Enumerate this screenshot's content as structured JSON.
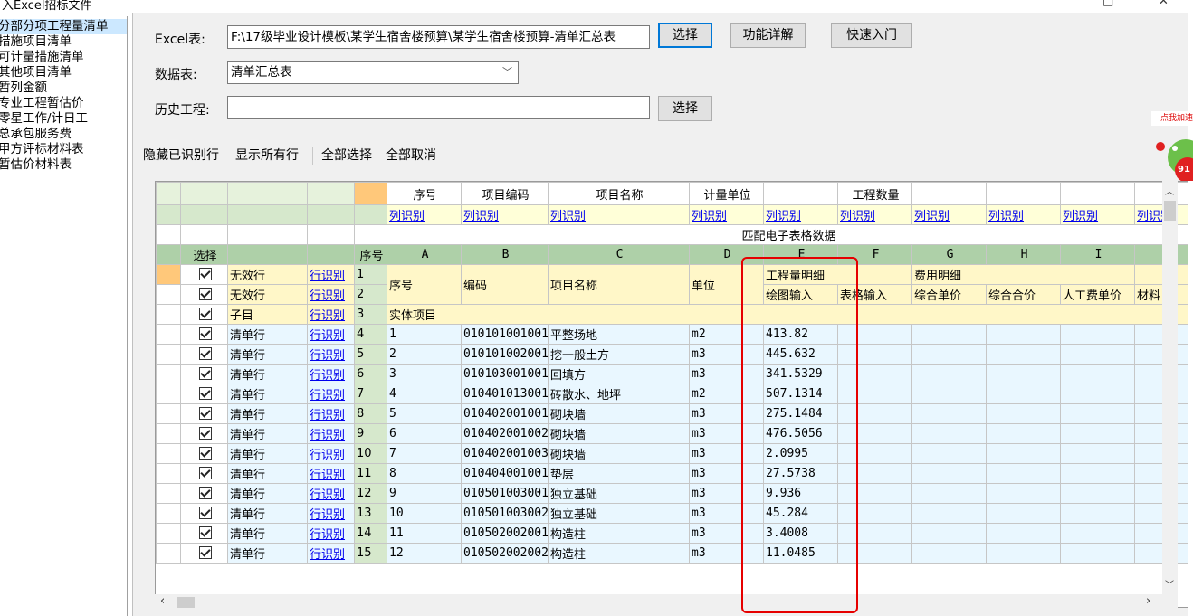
{
  "window": {
    "title": "入Excel招标文件",
    "restore_glyph": "□",
    "close_glyph": "✕"
  },
  "sidebar": {
    "items": [
      {
        "label": "分部分项工程量清单",
        "selected": true
      },
      {
        "label": "措施项目清单"
      },
      {
        "label": "可计量措施清单"
      },
      {
        "label": "其他项目清单"
      },
      {
        "label": "暂列金额"
      },
      {
        "label": "专业工程暂估价"
      },
      {
        "label": "零星工作/计日工"
      },
      {
        "label": "总承包服务费"
      },
      {
        "label": "甲方评标材料表"
      },
      {
        "label": "暂估价材料表"
      }
    ]
  },
  "form": {
    "excel_label": "Excel表:",
    "excel_path": "F:\\17级毕业设计模板\\某学生宿舍楼预算\\某学生宿舍楼预算-清单汇总表",
    "select_button": "选择",
    "feature_button": "功能详解",
    "quickstart_button": "快速入门",
    "sheet_label": "数据表:",
    "sheet_value": "清单汇总表",
    "history_label": "历史工程:",
    "history_value": "",
    "history_select_button": "选择"
  },
  "toolbar": {
    "hide_identified": "隐藏已识别行",
    "show_all": "显示所有行",
    "select_all": "全部选择",
    "cancel_all": "全部取消"
  },
  "grid": {
    "header_row1": [
      "序号",
      "项目编码",
      "项目名称",
      "计量单位",
      "",
      "工程数量",
      "",
      "",
      "",
      ""
    ],
    "col_identify": "列识别",
    "match_title": "匹配电子表格数据",
    "letter_row": {
      "select": "选择",
      "seq": "序号",
      "letters": [
        "A",
        "B",
        "C",
        "D",
        "E",
        "F",
        "G",
        "H",
        "I"
      ]
    },
    "row_identify": "行识别",
    "header_rows": [
      {
        "type": "无效行",
        "n": "1",
        "a": "序号",
        "b": "编码",
        "c": "项目名称",
        "d": "单位",
        "e": "工程量明细",
        "f": "",
        "g": "费用明细",
        "h": "",
        "i": ""
      },
      {
        "type": "无效行",
        "n": "2",
        "e": "绘图输入",
        "f": "表格输入",
        "g": "综合单价",
        "h": "综合合价",
        "i": "人工费单价",
        "j": "材料"
      }
    ],
    "subitem_row": {
      "type": "子目",
      "n": "3",
      "a": "实体项目"
    },
    "rows": [
      {
        "type": "清单行",
        "n": "4",
        "a": "1",
        "b": "010101001001",
        "c": "平整场地",
        "d": "m2",
        "e": "413.82"
      },
      {
        "type": "清单行",
        "n": "5",
        "a": "2",
        "b": "010101002001",
        "c": "挖一般土方",
        "d": "m3",
        "e": "445.632"
      },
      {
        "type": "清单行",
        "n": "6",
        "a": "3",
        "b": "010103001001",
        "c": "回填方",
        "d": "m3",
        "e": "341.5329"
      },
      {
        "type": "清单行",
        "n": "7",
        "a": "4",
        "b": "010401013001",
        "c": "砖散水、地坪",
        "d": "m2",
        "e": "507.1314"
      },
      {
        "type": "清单行",
        "n": "8",
        "a": "5",
        "b": "010402001001",
        "c": "砌块墙",
        "d": "m3",
        "e": "275.1484"
      },
      {
        "type": "清单行",
        "n": "9",
        "a": "6",
        "b": "010402001002",
        "c": "砌块墙",
        "d": "m3",
        "e": "476.5056"
      },
      {
        "type": "清单行",
        "n": "10",
        "a": "7",
        "b": "010402001003",
        "c": "砌块墙",
        "d": "m3",
        "e": "2.0995"
      },
      {
        "type": "清单行",
        "n": "11",
        "a": "8",
        "b": "010404001001",
        "c": "垫层",
        "d": "m3",
        "e": "27.5738"
      },
      {
        "type": "清单行",
        "n": "12",
        "a": "9",
        "b": "010501003001",
        "c": "独立基础",
        "d": "m3",
        "e": "9.936"
      },
      {
        "type": "清单行",
        "n": "13",
        "a": "10",
        "b": "010501003002",
        "c": "独立基础",
        "d": "m3",
        "e": "45.284"
      },
      {
        "type": "清单行",
        "n": "14",
        "a": "11",
        "b": "010502002001",
        "c": "构造柱",
        "d": "m3",
        "e": "3.4008"
      },
      {
        "type": "清单行",
        "n": "15",
        "a": "12",
        "b": "010502002002",
        "c": "构造柱",
        "d": "m3",
        "e": "11.0485"
      }
    ]
  },
  "speed_badge": {
    "label": "点我加速",
    "value": "91"
  },
  "colors": {
    "highlight_box": "#e60000",
    "selection": "#cce8ff",
    "green_header": "#aed0a8"
  }
}
